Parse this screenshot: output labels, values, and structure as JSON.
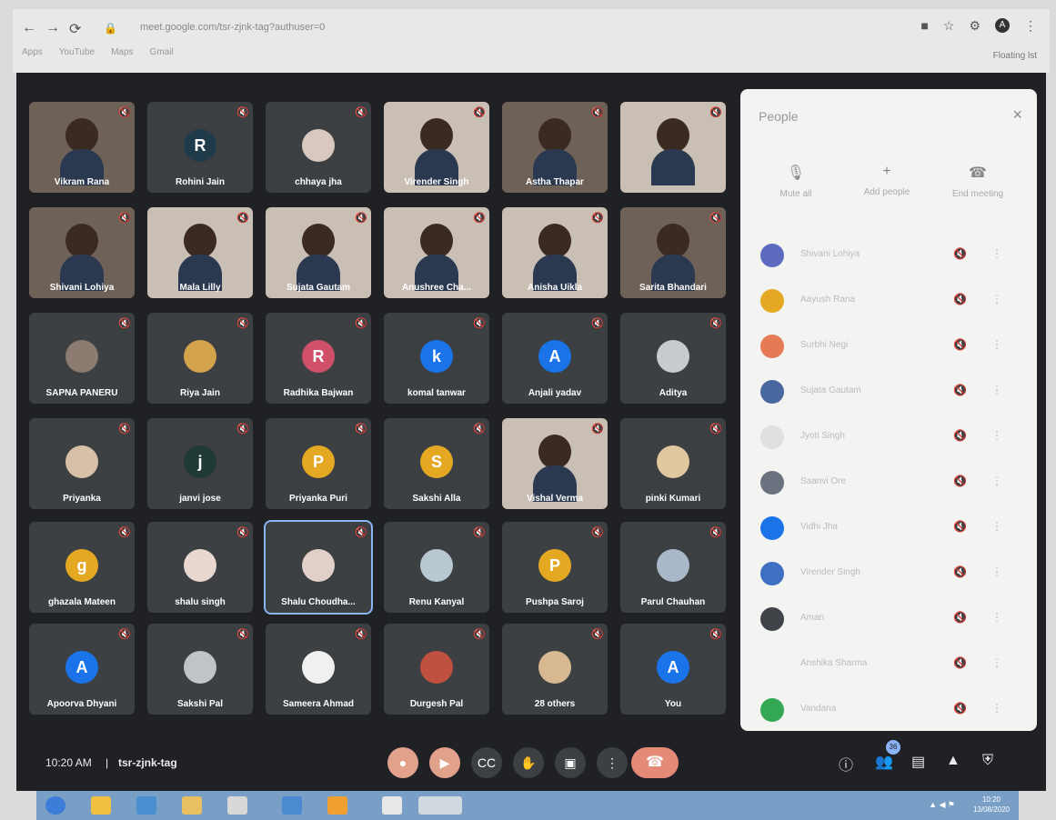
{
  "browser": {
    "url": "meet.google.com/tsr-zjnk-tag?authuser=0",
    "bookmarks": [
      "Apps",
      "YouTube",
      "Maps",
      "Gmail"
    ],
    "floating_label": "Floating lst",
    "profile_initial": "A"
  },
  "meeting": {
    "time": "10:20 AM",
    "separator": "|",
    "code": "tsr-zjnk-tag"
  },
  "tiles": [
    {
      "name": "Vikram Rana",
      "type": "video"
    },
    {
      "name": "Rohini Jain",
      "type": "avatar",
      "initial": "R",
      "color": "#1f3a4a"
    },
    {
      "name": "chhaya jha",
      "type": "avatar-photo",
      "initial": "",
      "color": "#d8c8c0"
    },
    {
      "name": "Virender Singh",
      "type": "video",
      "light": true
    },
    {
      "name": "Astha Thapar",
      "type": "video"
    },
    {
      "name": "",
      "type": "video",
      "light": true
    },
    {
      "name": "Shivani Lohiya",
      "type": "video"
    },
    {
      "name": "Mala Lilly",
      "type": "video",
      "light": true
    },
    {
      "name": "Sujata Gautam",
      "type": "video",
      "light": true
    },
    {
      "name": "Anushree Cha...",
      "type": "video",
      "light": true
    },
    {
      "name": "Anisha Uikla",
      "type": "video",
      "light": true
    },
    {
      "name": "Sarita Bhandari",
      "type": "video"
    },
    {
      "name": "SAPNA PANERU",
      "type": "avatar-photo",
      "initial": "",
      "color": "#8a7a70"
    },
    {
      "name": "Riya Jain",
      "type": "avatar-photo",
      "initial": "",
      "color": "#d4a44c"
    },
    {
      "name": "Radhika Bajwan",
      "type": "avatar",
      "initial": "R",
      "color": "#d0506a"
    },
    {
      "name": "komal tanwar",
      "type": "avatar",
      "initial": "k",
      "color": "#1a73e8"
    },
    {
      "name": "Anjali yadav",
      "type": "avatar",
      "initial": "A",
      "color": "#1a73e8"
    },
    {
      "name": "Aditya",
      "type": "avatar-photo",
      "initial": "",
      "color": "#c8ccd0"
    },
    {
      "name": "Priyanka",
      "type": "avatar-photo",
      "initial": "",
      "color": "#d8c0a8"
    },
    {
      "name": "janvi jose",
      "type": "avatar",
      "initial": "j",
      "color": "#1f3a36"
    },
    {
      "name": "Priyanka Puri",
      "type": "avatar",
      "initial": "P",
      "color": "#e5a823"
    },
    {
      "name": "Sakshi Alla",
      "type": "avatar",
      "initial": "S",
      "color": "#e5a823"
    },
    {
      "name": "Vishal Verma",
      "type": "video",
      "light": true
    },
    {
      "name": "pinki Kumari",
      "type": "avatar-photo",
      "initial": "",
      "color": "#e0c8a0"
    },
    {
      "name": "ghazala Mateen",
      "type": "avatar",
      "initial": "g",
      "color": "#e5a823"
    },
    {
      "name": "shalu singh",
      "type": "avatar-photo",
      "initial": "",
      "color": "#e8d8d0"
    },
    {
      "name": "Shalu Choudha...",
      "type": "avatar-photo",
      "initial": "",
      "color": "#e0d0c8",
      "active": true
    },
    {
      "name": "Renu Kanyal",
      "type": "avatar-photo",
      "initial": "",
      "color": "#b8c8d0"
    },
    {
      "name": "Pushpa Saroj",
      "type": "avatar",
      "initial": "P",
      "color": "#e5a823"
    },
    {
      "name": "Parul Chauhan",
      "type": "avatar-photo",
      "initial": "",
      "color": "#a8b8c8"
    },
    {
      "name": "Apoorva Dhyani",
      "type": "avatar",
      "initial": "A",
      "color": "#1a73e8"
    },
    {
      "name": "Sakshi Pal",
      "type": "avatar-photo",
      "initial": "",
      "color": "#c0c4c8"
    },
    {
      "name": "Sameera Ahmad",
      "type": "avatar-photo",
      "initial": "",
      "color": "#f0f0f0"
    },
    {
      "name": "Durgesh Pal",
      "type": "avatar-photo",
      "initial": "",
      "color": "#c05040"
    },
    {
      "name": "28 others",
      "type": "others",
      "initial": "",
      "color": "#d8b890"
    },
    {
      "name": "You",
      "type": "avatar",
      "initial": "A",
      "color": "#1a73e8"
    }
  ],
  "panel": {
    "title": "People",
    "close": "×",
    "actions": [
      {
        "icon": "mic-off-icon",
        "glyph": "🎙",
        "label": "Mute all"
      },
      {
        "icon": "add-people-icon",
        "glyph": "+",
        "label": "Add people"
      },
      {
        "icon": "end-meeting-icon",
        "glyph": "☎",
        "label": "End meeting"
      }
    ],
    "participants": [
      {
        "name": "Shivani Lohiya",
        "color": "#5c6bc0"
      },
      {
        "name": "Aayush Rana",
        "color": "#e5a823"
      },
      {
        "name": "Surbhi Negi",
        "color": "#e57a55"
      },
      {
        "name": "Sujata Gautam",
        "color": "#4a68a0"
      },
      {
        "name": "Jyoti Singh",
        "color": "#e0e0e0"
      },
      {
        "name": "Saanvi Ore",
        "color": "#6a7280"
      },
      {
        "name": "Vidhi Jha",
        "color": "#1a73e8"
      },
      {
        "name": "Virender Singh",
        "color": "#3f6fc0"
      },
      {
        "name": "Aman",
        "color": "#404448"
      },
      {
        "name": "Anshika Sharma",
        "color": "#f3f3f1"
      },
      {
        "name": "Vandana",
        "color": "#34a853"
      }
    ]
  },
  "controls": {
    "left": [
      "mic-icon",
      "camera-icon",
      "captions-icon",
      "raise-hand-icon",
      "present-icon",
      "more-options-icon"
    ],
    "right": [
      "info-icon",
      "people-icon",
      "chat-icon",
      "activities-icon",
      "security-icon"
    ],
    "people_badge": "36"
  },
  "taskbar": {
    "time": "10:20",
    "date": "13/08/2020"
  }
}
